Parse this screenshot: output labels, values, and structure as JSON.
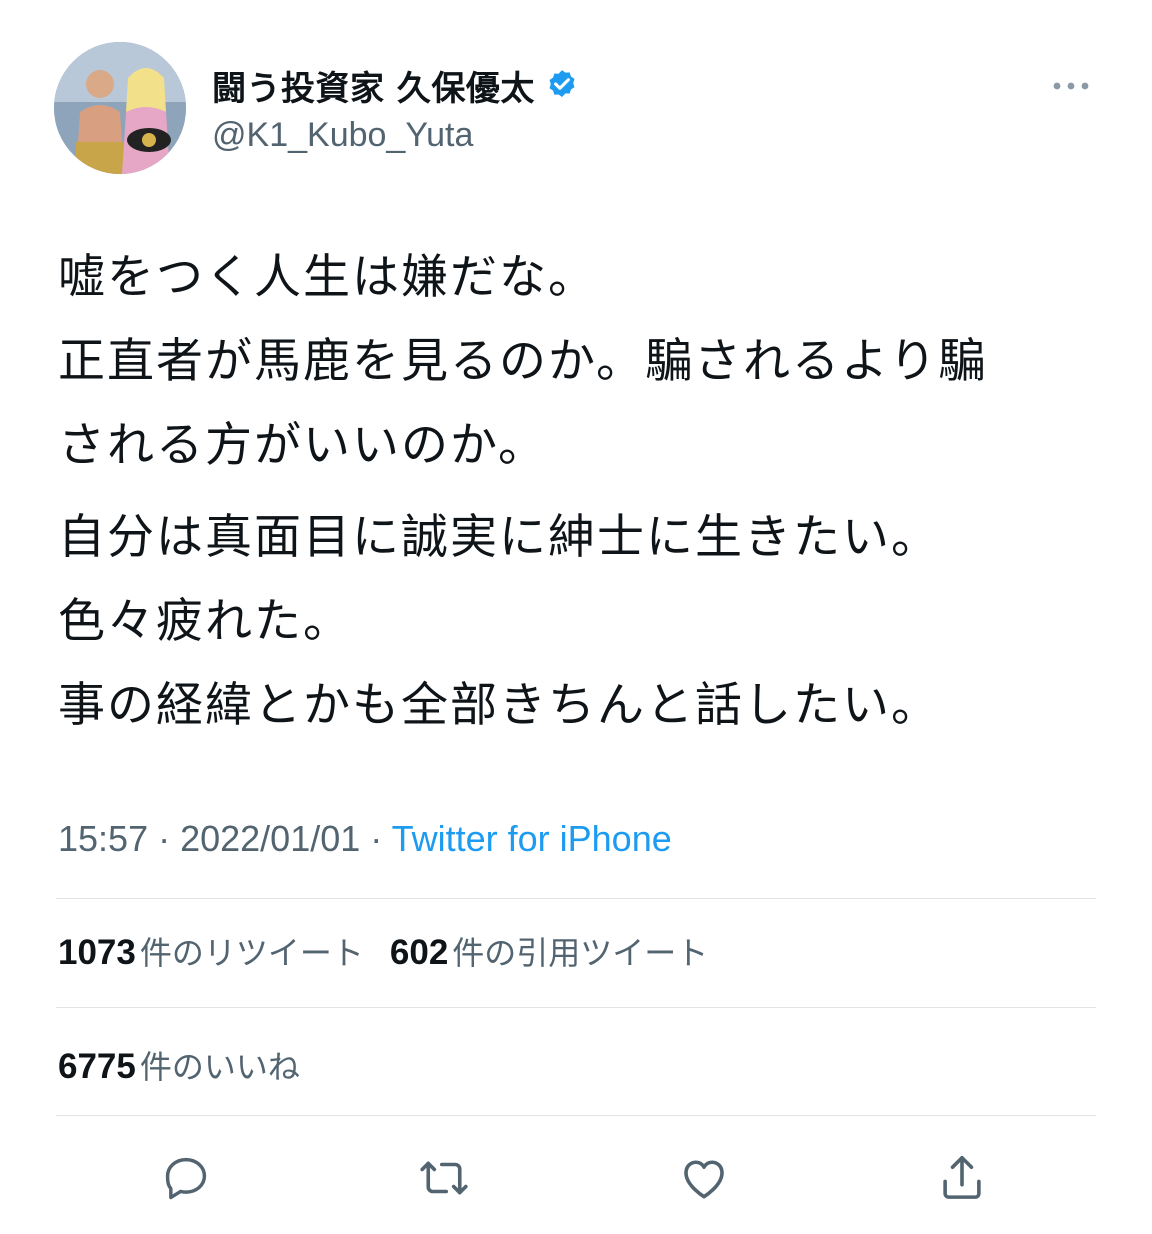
{
  "author": {
    "display_name": "闘う投資家 久保優太",
    "handle": "@K1_Kubo_Yuta",
    "verified": true
  },
  "tweet": {
    "paragraphs": [
      [
        "嘘をつく人生は嫌だな。",
        "正直者が馬鹿を見るのか。騙されるより騙",
        "される方がいいのか。"
      ],
      [
        "自分は真面目に誠実に紳士に生きたい。",
        "色々疲れた。",
        "事の経緯とかも全部きちんと話したい。"
      ]
    ]
  },
  "meta": {
    "time": "15:57",
    "separator": " · ",
    "date": "2022/01/01",
    "source": "Twitter for iPhone"
  },
  "stats": {
    "retweets": {
      "count": "1073",
      "label": "件のリツイート"
    },
    "quotes": {
      "count": "602",
      "label": "件の引用ツイート"
    },
    "likes": {
      "count": "6775",
      "label": "件のいいね"
    }
  },
  "icons": {
    "more": "more-icon",
    "reply": "reply-icon",
    "retweet": "retweet-icon",
    "like": "like-icon",
    "share": "share-icon",
    "verified": "verified-badge-icon"
  },
  "colors": {
    "text": "#0f1419",
    "secondary": "#536471",
    "accent": "#1d9bf0",
    "divider": "#e1e4e7"
  }
}
